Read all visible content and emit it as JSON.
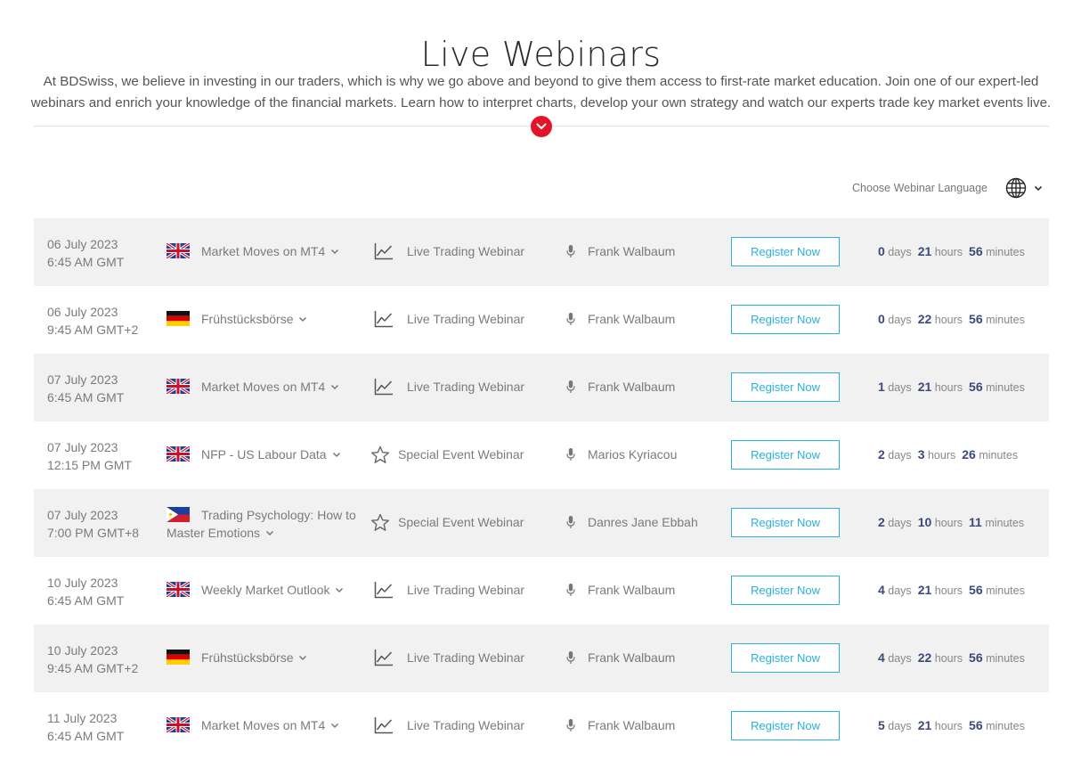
{
  "page": {
    "title": "Live Webinars",
    "intro_line1": "At BDSwiss, we believe in investing in our traders, which is why we go above and beyond to give them access to first-rate market education. Join one of our expert-led",
    "intro_line2": "webinars and enrich your knowledge of the financial markets. Learn how to interpret charts, develop your own strategy and watch our experts trade key market events live."
  },
  "language": {
    "label": "Choose Webinar Language",
    "icon": "globe-icon"
  },
  "colors": {
    "accent_red": "#e3152b",
    "register_blue": "#2bb3d9",
    "countdown_number": "#3c4a7a",
    "row_shade": "#f1f1f1"
  },
  "units": {
    "days": "days",
    "hours": "hours",
    "minutes": "minutes"
  },
  "register_label": "Register Now",
  "webinars": [
    {
      "date": "06 July 2023",
      "time": "6:45 AM GMT",
      "flag": "uk-flag-icon",
      "topic": "Market Moves on MT4",
      "type": "Live Trading Webinar",
      "type_icon": "line-chart-icon",
      "host": "Frank Walbaum",
      "days": "0",
      "hours": "21",
      "minutes": "56"
    },
    {
      "date": "06 July 2023",
      "time": "9:45 AM GMT+2",
      "flag": "germany-flag-icon",
      "topic": "Frühstücksbörse",
      "type": "Live Trading Webinar",
      "type_icon": "line-chart-icon",
      "host": "Frank Walbaum",
      "days": "0",
      "hours": "22",
      "minutes": "56"
    },
    {
      "date": "07 July 2023",
      "time": "6:45 AM GMT",
      "flag": "uk-flag-icon",
      "topic": "Market Moves on MT4",
      "type": "Live Trading Webinar",
      "type_icon": "line-chart-icon",
      "host": "Frank Walbaum",
      "days": "1",
      "hours": "21",
      "minutes": "56"
    },
    {
      "date": "07 July 2023",
      "time": "12:15 PM GMT",
      "flag": "uk-flag-icon",
      "topic": "NFP - US Labour Data",
      "type": "Special Event Webinar",
      "type_icon": "star-icon",
      "host": "Marios Kyriacou",
      "days": "2",
      "hours": "3",
      "minutes": "26"
    },
    {
      "date": "07 July 2023",
      "time": "7:00 PM GMT+8",
      "flag": "philippines-flag-icon",
      "topic": "Trading Psychology: How to Master Emotions",
      "type": "Special Event Webinar",
      "type_icon": "star-icon",
      "host": "Danres Jane Ebbah",
      "days": "2",
      "hours": "10",
      "minutes": "11"
    },
    {
      "date": "10 July 2023",
      "time": "6:45 AM GMT",
      "flag": "uk-flag-icon",
      "topic": "Weekly Market Outlook",
      "type": "Live Trading Webinar",
      "type_icon": "line-chart-icon",
      "host": "Frank Walbaum",
      "days": "4",
      "hours": "21",
      "minutes": "56"
    },
    {
      "date": "10 July 2023",
      "time": "9:45 AM GMT+2",
      "flag": "germany-flag-icon",
      "topic": "Frühstücksbörse",
      "type": "Live Trading Webinar",
      "type_icon": "line-chart-icon",
      "host": "Frank Walbaum",
      "days": "4",
      "hours": "22",
      "minutes": "56"
    },
    {
      "date": "11 July 2023",
      "time": "6:45 AM GMT",
      "flag": "uk-flag-icon",
      "topic": "Market Moves on MT4",
      "type": "Live Trading Webinar",
      "type_icon": "line-chart-icon",
      "host": "Frank Walbaum",
      "days": "5",
      "hours": "21",
      "minutes": "56"
    }
  ]
}
